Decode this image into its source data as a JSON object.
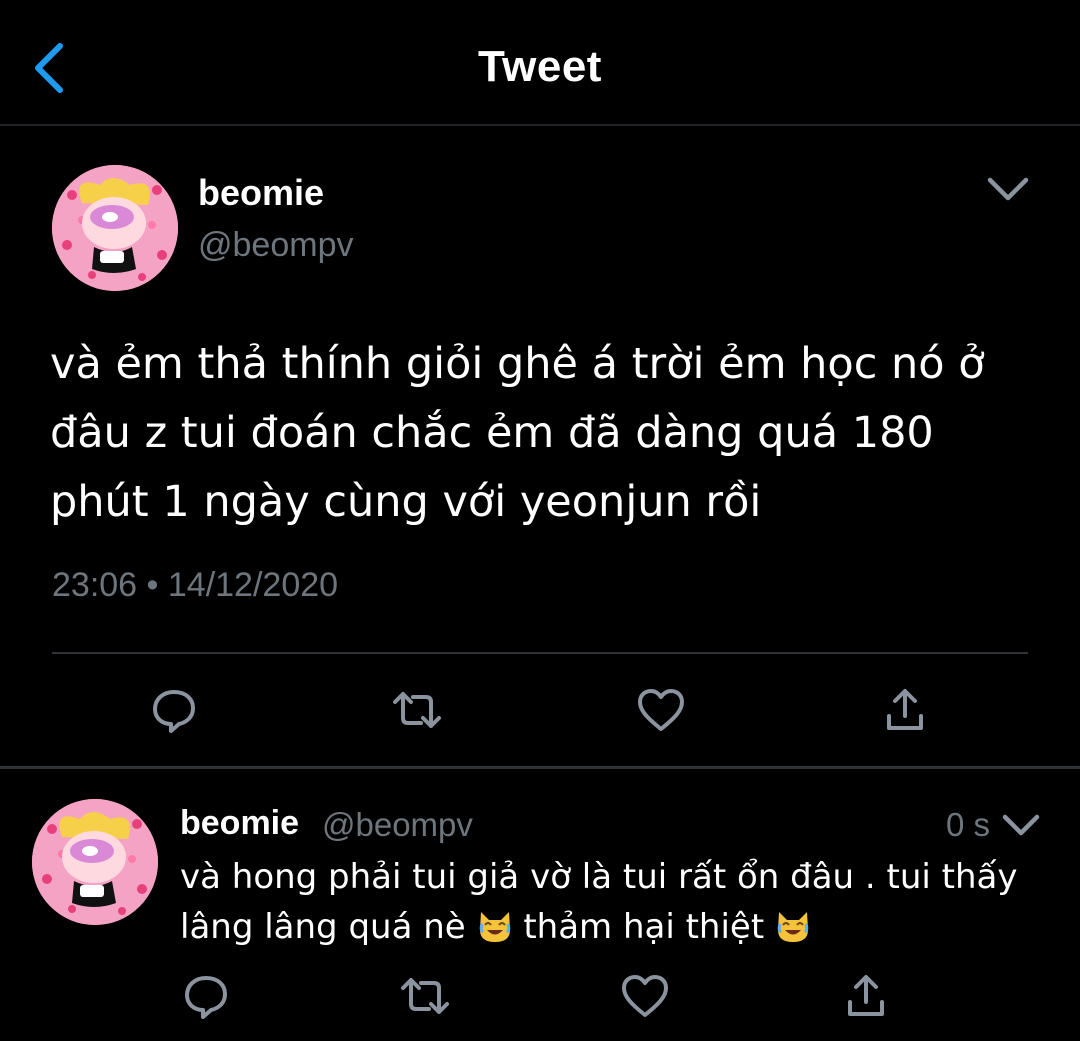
{
  "header": {
    "title": "Tweet"
  },
  "main_tweet": {
    "author_name": "beomie",
    "author_handle": "@beompv",
    "text": "và ẻm thả thính giỏi ghê á trời ẻm học nó ở đâu z tui đoán chắc ẻm đã dàng quá 180 phút 1 ngày cùng với yeonjun rồi",
    "timestamp": "23:06 • 14/12/2020"
  },
  "reply": {
    "author_name": "beomie",
    "author_handle": "@beompv",
    "time": "0 s",
    "text_part1": "và hong phải tui giả vờ là tui rất ổn đâu . tui thấy lâng lâng quá nè",
    "text_part2": "thảm hại thiệt",
    "emoji": "joy-cat-emoji"
  },
  "icons": {
    "back": "chevron-left-icon",
    "more": "chevron-down-icon",
    "reply": "reply-icon",
    "retweet": "retweet-icon",
    "like": "heart-icon",
    "share": "share-icon"
  },
  "colors": {
    "background": "#000000",
    "accent": "#1d9bf0",
    "secondary_text": "#6e767d",
    "divider": "#2f3336"
  }
}
